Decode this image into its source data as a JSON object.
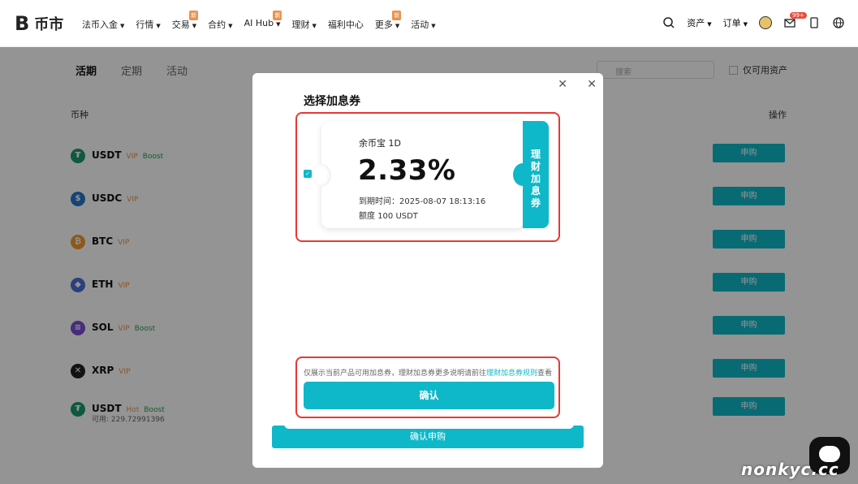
{
  "brand": {
    "mark": "B",
    "name": "币市"
  },
  "nav": {
    "items": [
      {
        "label": "法币入金",
        "caret": true,
        "badge": ""
      },
      {
        "label": "行情",
        "caret": true,
        "badge": ""
      },
      {
        "label": "交易",
        "caret": true,
        "badge": "新"
      },
      {
        "label": "合约",
        "caret": true,
        "badge": ""
      },
      {
        "label": "AI Hub",
        "caret": true,
        "badge": "新"
      },
      {
        "label": "理财",
        "caret": true,
        "badge": ""
      },
      {
        "label": "福利中心",
        "caret": false,
        "badge": ""
      },
      {
        "label": "更多",
        "caret": true,
        "badge": "新"
      },
      {
        "label": "活动",
        "caret": true,
        "badge": ""
      }
    ],
    "assets_label": "资产",
    "orders_label": "订单",
    "mail_badge": "99+"
  },
  "tabs": [
    "活期",
    "定期",
    "活动"
  ],
  "search": {
    "placeholder": "搜索"
  },
  "filter": {
    "only_available": "仅可用资产"
  },
  "table": {
    "col_coin": "币种",
    "col_action": "操作",
    "buy_label": "申购",
    "rows": [
      {
        "name": "USDT",
        "vip": "VIP",
        "boost": "Boost",
        "hot": "",
        "sub": "",
        "color": "#1a9a6c",
        "glyph": "₮"
      },
      {
        "name": "USDC",
        "vip": "VIP",
        "boost": "",
        "hot": "",
        "sub": "",
        "color": "#2775ca",
        "glyph": "$"
      },
      {
        "name": "BTC",
        "vip": "VIP",
        "boost": "",
        "hot": "",
        "sub": "",
        "color": "#f09a2b",
        "glyph": "₿"
      },
      {
        "name": "ETH",
        "vip": "VIP",
        "boost": "",
        "hot": "",
        "sub": "",
        "color": "#4a6fd8",
        "glyph": "◆"
      },
      {
        "name": "SOL",
        "vip": "VIP",
        "boost": "Boost",
        "hot": "",
        "sub": "",
        "color": "#7a4fd1",
        "glyph": "≡"
      },
      {
        "name": "XRP",
        "vip": "VIP",
        "boost": "",
        "hot": "",
        "sub": "",
        "color": "#222222",
        "glyph": "✕"
      },
      {
        "name": "USDT",
        "vip": "",
        "boost": "Boost",
        "hot": "Hot",
        "sub": "可用: 229.72991396",
        "color": "#1a9a6c",
        "glyph": "₮"
      }
    ]
  },
  "back_panel": {
    "confirm_label": "确认申购"
  },
  "modal": {
    "title": "选择加息券",
    "coupon": {
      "product": "余币宝 1D",
      "rate": "2.33%",
      "expire": "到期时间：2025-08-07 18:13:16",
      "amount": "额度 100 USDT",
      "side_label": "理财加息券",
      "selected": true
    },
    "note_prefix": "仅展示当前产品可用加息券，理财加息券更多说明请前往",
    "note_link": "理财加息券规则",
    "note_suffix": "查看",
    "confirm_label": "确认"
  },
  "watermark": "nonkyc.cc",
  "colors": {
    "accent": "#0fb8c8",
    "highlight": "#e53935",
    "vip": "#e8934d",
    "boost": "#2b9c4a"
  }
}
